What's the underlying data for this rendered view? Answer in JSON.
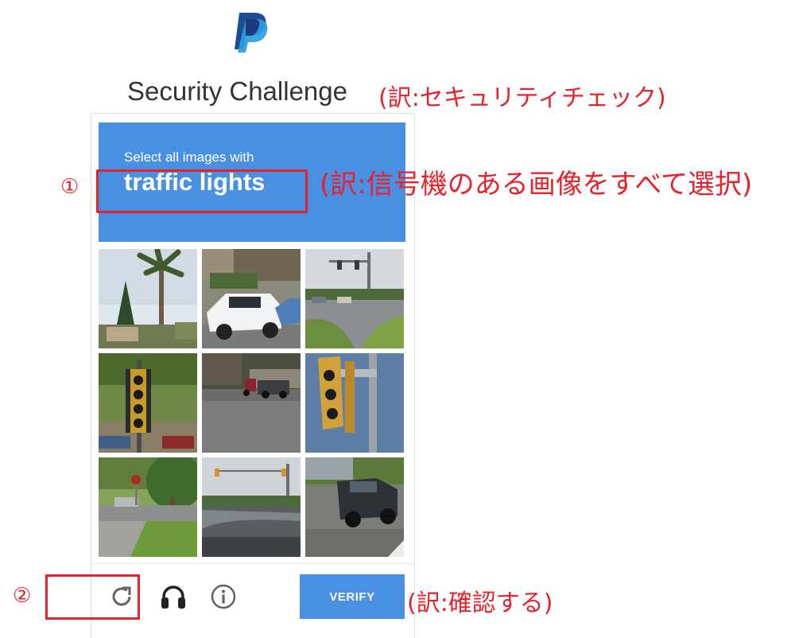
{
  "title": "Security Challenge",
  "title_translation": "(訳:セキュリティチェック)",
  "captcha": {
    "instruction": "Select all images with",
    "target": "traffic lights",
    "verify_label": "VERIFY",
    "tiles": [
      {
        "subject": "palm-trees"
      },
      {
        "subject": "parked-suv"
      },
      {
        "subject": "traffic-light-intersection"
      },
      {
        "subject": "traffic-light"
      },
      {
        "subject": "street-motorcycles"
      },
      {
        "subject": "traffic-light-closeup"
      },
      {
        "subject": "stop-sign-corner"
      },
      {
        "subject": "distant-traffic-lights"
      },
      {
        "subject": "pickup-truck"
      }
    ],
    "icons": [
      "reload-icon",
      "headphones-icon",
      "info-icon"
    ],
    "accent_color": "#4a90e2"
  },
  "annotations": {
    "marker_1": "①",
    "marker_1_translation": "(訳:信号機のある画像をすべて選択)",
    "marker_2": "②",
    "verify_translation": "(訳:確認する)",
    "color": "#e8212b"
  }
}
